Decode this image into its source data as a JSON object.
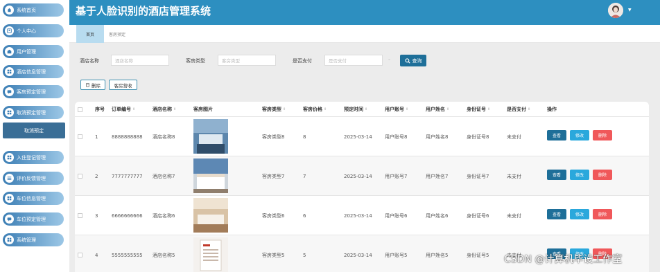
{
  "app": {
    "title": "基于人脸识别的酒店管理系统"
  },
  "sidebar": {
    "items": [
      {
        "label": "系统首页",
        "icon": "home-icon"
      },
      {
        "label": "个人中心",
        "icon": "person-icon"
      },
      {
        "label": "用户管理",
        "icon": "users-icon"
      },
      {
        "label": "酒店信息管理",
        "icon": "grid-icon"
      },
      {
        "label": "客房预定管理",
        "icon": "chat-icon"
      },
      {
        "label": "取消预定管理",
        "icon": "grid-icon"
      },
      {
        "label": "入住登记管理",
        "icon": "grid-icon"
      },
      {
        "label": "评价反馈管理",
        "icon": "list-icon"
      },
      {
        "label": "车位信息管理",
        "icon": "grid-icon"
      },
      {
        "label": "车位预定管理",
        "icon": "chat-icon"
      },
      {
        "label": "系统管理",
        "icon": "grid-icon"
      }
    ],
    "active_sub": "取消预定"
  },
  "tabs": [
    {
      "label": "首页"
    },
    {
      "label": "客房预定"
    }
  ],
  "search": {
    "hotel_label": "酒店名称",
    "hotel_placeholder": "酒店名称",
    "roomtype_label": "客房类型",
    "roomtype_placeholder": "客房类型",
    "paid_label": "是否支付",
    "paid_placeholder": "是否支付",
    "query_button": "查询"
  },
  "actions": {
    "delete_label": "删除",
    "export_label": "客房营收"
  },
  "table": {
    "columns": [
      "序号",
      "订单编号",
      "酒店名称",
      "客房图片",
      "客房类型",
      "客房价格",
      "预定时间",
      "用户账号",
      "用户姓名",
      "身份证号",
      "是否支付",
      "操作"
    ],
    "row_buttons": {
      "view": "查看",
      "edit": "修改",
      "delete": "删除"
    },
    "rows": [
      {
        "index": "1",
        "order_no": "8888888888",
        "hotel": "酒店名称8",
        "room_type": "客房类型8",
        "price": "8",
        "date": "2025-03-14",
        "account": "用户账号8",
        "name": "用户姓名8",
        "id_no": "身份证号8",
        "paid": "未支付"
      },
      {
        "index": "2",
        "order_no": "7777777777",
        "hotel": "酒店名称7",
        "room_type": "客房类型7",
        "price": "7",
        "date": "2025-03-14",
        "account": "用户账号7",
        "name": "用户姓名7",
        "id_no": "身份证号7",
        "paid": "未支付"
      },
      {
        "index": "3",
        "order_no": "6666666666",
        "hotel": "酒店名称6",
        "room_type": "客房类型6",
        "price": "6",
        "date": "2025-03-14",
        "account": "用户账号6",
        "name": "用户姓名6",
        "id_no": "身份证号6",
        "paid": "未支付"
      },
      {
        "index": "4",
        "order_no": "5555555555",
        "hotel": "酒店名称5",
        "room_type": "客房类型5",
        "price": "5",
        "date": "2025-03-14",
        "account": "用户账号5",
        "name": "用户姓名5",
        "id_no": "身份证号5",
        "paid": "未支付"
      }
    ]
  },
  "watermark": "CSDN @计算机毕设工作室",
  "colors": {
    "header": "#2d8fc0",
    "view_button": "#1e6f99",
    "edit_button": "#2aa8dc",
    "delete_button": "#f0585a"
  }
}
